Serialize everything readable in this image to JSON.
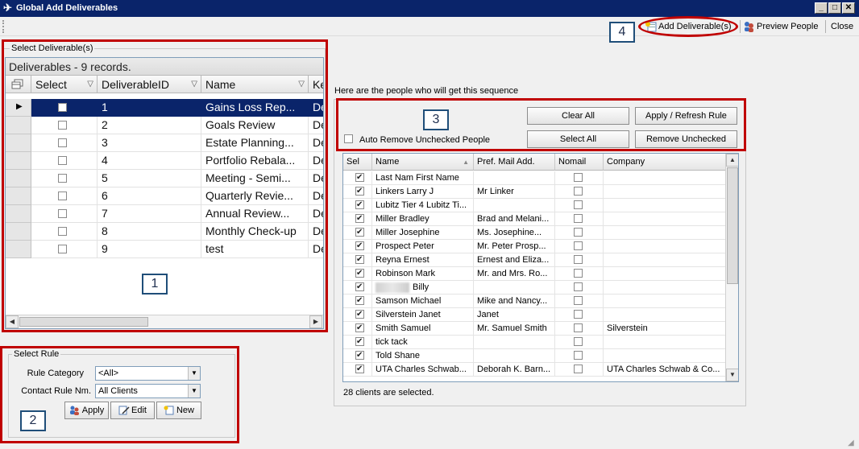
{
  "window": {
    "title": "Global Add Deliverables",
    "min": "_",
    "max": "□",
    "close": "✕"
  },
  "toolbar": {
    "add_deliverables": "Add Deliverable(s)",
    "preview_people": "Preview People",
    "close": "Close"
  },
  "deliverables": {
    "group_label": "Select Deliverable(s)",
    "caption": "Deliverables - 9 records.",
    "columns": [
      "Select",
      "DeliverableID",
      "Name",
      "Ke"
    ],
    "rows": [
      {
        "id": "1",
        "name": "Gains Loss Rep...",
        "key": "De",
        "selected": true
      },
      {
        "id": "2",
        "name": "Goals Review",
        "key": "De"
      },
      {
        "id": "3",
        "name": "Estate Planning...",
        "key": "De"
      },
      {
        "id": "4",
        "name": "Portfolio Rebala...",
        "key": "De"
      },
      {
        "id": "5",
        "name": "Meeting - Semi...",
        "key": "De"
      },
      {
        "id": "6",
        "name": "Quarterly Revie...",
        "key": "De"
      },
      {
        "id": "7",
        "name": "Annual Review...",
        "key": "De"
      },
      {
        "id": "8",
        "name": "Monthly Check-up",
        "key": "De"
      },
      {
        "id": "9",
        "name": "test",
        "key": "De"
      }
    ]
  },
  "rule": {
    "group_label": "Select Rule",
    "category_label": "Rule Category",
    "category_value": "<All>",
    "contact_label": "Contact Rule Nm.",
    "contact_value": "All Clients",
    "apply": "Apply",
    "edit": "Edit",
    "new": "New"
  },
  "people": {
    "intro": "Here are the people who will get this sequence",
    "auto_remove": "Auto Remove Unchecked People",
    "clear_all": "Clear All",
    "apply_refresh": "Apply / Refresh Rule",
    "select_all": "Select All",
    "remove_unchecked": "Remove Unchecked",
    "columns": [
      "Sel",
      "Name",
      "Pref. Mail Add.",
      "Nomail",
      "Company"
    ],
    "rows": [
      {
        "name": "Last Nam First Name",
        "mail": "",
        "company": ""
      },
      {
        "name": "Linkers Larry J",
        "mail": "Mr Linker",
        "company": ""
      },
      {
        "name": "Lubitz Tier 4 Lubitz Ti...",
        "mail": "",
        "company": ""
      },
      {
        "name": "Miller Bradley",
        "mail": "Brad  and  Melani...",
        "company": ""
      },
      {
        "name": "Miller Josephine",
        "mail": "Ms.  Josephine...",
        "company": ""
      },
      {
        "name": "Prospect Peter",
        "mail": "Mr.  Peter  Prosp...",
        "company": ""
      },
      {
        "name": "Reyna Ernest",
        "mail": "Ernest  and  Eliza...",
        "company": ""
      },
      {
        "name": "Robinson Mark",
        "mail": "Mr.  and Mrs.  Ro...",
        "company": ""
      },
      {
        "name": "Billy",
        "mail": "",
        "company": "",
        "redacted": true
      },
      {
        "name": "Samson Michael",
        "mail": "Mike  and Nancy...",
        "company": ""
      },
      {
        "name": "Silverstein Janet",
        "mail": "Janet",
        "company": ""
      },
      {
        "name": "Smith Samuel",
        "mail": "Mr. Samuel Smith",
        "company": "Silverstein"
      },
      {
        "name": "tick tack",
        "mail": "",
        "company": ""
      },
      {
        "name": "Told Shane",
        "mail": "",
        "company": ""
      },
      {
        "name": "UTA  Charles  Schwab...",
        "mail": "Deborah  K.  Barn...",
        "company": "UTA  Charles  Schwab  &  Co..."
      }
    ],
    "status": "28 clients are selected."
  },
  "annotations": [
    "1",
    "2",
    "3",
    "4"
  ],
  "colors": {
    "annotation": "#c00000",
    "selection": "#0a246a"
  }
}
